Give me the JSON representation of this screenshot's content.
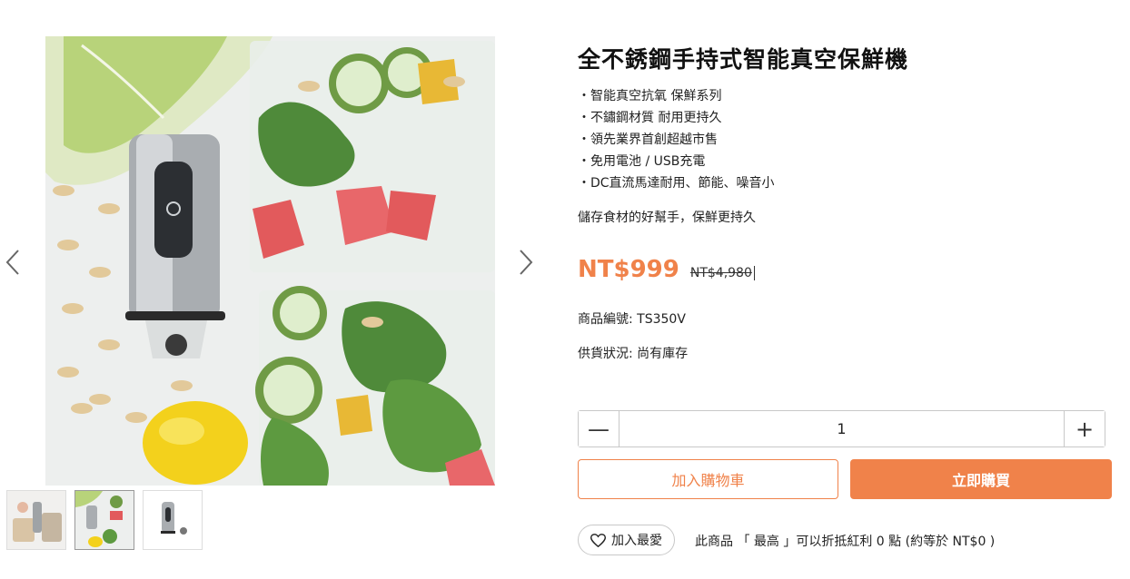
{
  "gallery": {
    "prev_icon": "chevron-left-icon",
    "next_icon": "chevron-right-icon",
    "thumbnails": [
      {
        "name": "thumbnail-1",
        "active": false
      },
      {
        "name": "thumbnail-2",
        "active": true
      },
      {
        "name": "thumbnail-3",
        "active": false
      }
    ]
  },
  "product": {
    "title": "全不銹鋼手持式智能真空保鮮機",
    "features": [
      "智能真空抗氧 保鮮系列",
      "不鏽鋼材質 耐用更持久",
      "領先業界首創超越市售",
      "免用電池 / USB充電",
      "DC直流馬達耐用、節能、噪音小"
    ],
    "tagline": "儲存食材的好幫手，保鮮更持久",
    "price": "NT$999",
    "original_price": "NT$4,980",
    "sku_text": "商品編號: TS350V",
    "stock_text": "供貨狀況: 尚有庫存"
  },
  "quantity": {
    "value": "1",
    "minus_symbol": "—",
    "plus_symbol": "+"
  },
  "actions": {
    "add_to_cart": "加入購物車",
    "buy_now": "立即購買",
    "wishlist": "加入最愛",
    "wishlist_icon": "heart-icon"
  },
  "bonus_text": "此商品 「 最高 」可以折抵紅利 0 點 (約等於 NT$0 )",
  "colors": {
    "accent": "#f0824a"
  }
}
